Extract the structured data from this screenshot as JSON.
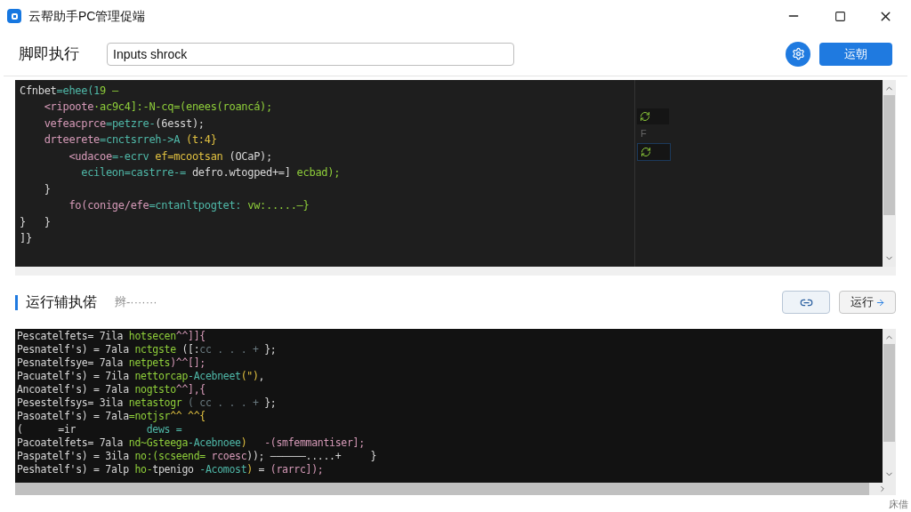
{
  "window": {
    "title": "云帮助手PC管理促端"
  },
  "toolbar": {
    "heading": "脚即执行",
    "input": {
      "value": "Inputs shrock"
    },
    "primary_button": "运朝"
  },
  "editor": {
    "lines": [
      [
        {
          "kind": "plain",
          "text": "Cfnbet"
        },
        {
          "kind": "teal",
          "text": "=ehee(1"
        },
        {
          "kind": "green",
          "text": "9 –"
        }
      ],
      [
        {
          "kind": "pink",
          "text": "    <ripoote"
        },
        {
          "kind": "green",
          "text": "·ac9c4]:-N-cq=(enees(roancá);"
        }
      ],
      [
        {
          "kind": "pink",
          "text": "    vefeacprce"
        },
        {
          "kind": "teal",
          "text": "=petzre-"
        },
        {
          "kind": "plain",
          "text": "(6esst);"
        }
      ],
      [
        {
          "kind": "pink",
          "text": "    drteerete"
        },
        {
          "kind": "teal",
          "text": "=cnctsrreh->A "
        },
        {
          "kind": "yellow",
          "text": "(t:4}"
        }
      ],
      [
        {
          "kind": "pink",
          "text": "        <udacoe"
        },
        {
          "kind": "teal",
          "text": "=-ecrv "
        },
        {
          "kind": "yellow",
          "text": "ef=mcootsan "
        },
        {
          "kind": "plain",
          "text": "(OCaP);"
        }
      ],
      [
        {
          "kind": "teal",
          "text": "          ecileon=castrre-= "
        },
        {
          "kind": "plain",
          "text": "defro.wtogped+=] "
        },
        {
          "kind": "green",
          "text": "ecbad);"
        }
      ],
      [
        {
          "kind": "plain",
          "text": "    }"
        }
      ],
      [
        {
          "kind": "pink",
          "text": "        fo(conige/efe"
        },
        {
          "kind": "teal",
          "text": "=cntanltpogtet: "
        },
        {
          "kind": "green",
          "text": "vw:.....–}"
        }
      ],
      [
        {
          "kind": "plain",
          "text": "}   }"
        }
      ],
      [
        {
          "kind": "plain",
          "text": "]}"
        }
      ]
    ],
    "side_label": "F"
  },
  "output": {
    "heading": "运行辅执偌",
    "subheading": "辫-·······",
    "run_button": "运行",
    "lines": [
      [
        {
          "kind": "plain",
          "text": "Pescatelfets= 7ila "
        },
        {
          "kind": "green",
          "text": "hotsecen"
        },
        {
          "kind": "pink",
          "text": "^^]]{"
        }
      ],
      [
        {
          "kind": "plain",
          "text": "Pesnatelf's) = 7ala "
        },
        {
          "kind": "green",
          "text": "nctgste "
        },
        {
          "kind": "plain",
          "text": "([:"
        },
        {
          "kind": "dim",
          "text": "cc . . . +"
        },
        {
          "kind": "plain",
          "text": " };"
        }
      ],
      [
        {
          "kind": "plain",
          "text": "Pesnatelfsye= 7ala "
        },
        {
          "kind": "green",
          "text": "netpets"
        },
        {
          "kind": "pink",
          "text": ")^^[];"
        }
      ],
      [
        {
          "kind": "plain",
          "text": "Pacuatelf's) = 7ila "
        },
        {
          "kind": "green",
          "text": "nettorcap"
        },
        {
          "kind": "teal",
          "text": "-Acebneet"
        },
        {
          "kind": "yellow",
          "text": "(\")"
        },
        {
          "kind": "plain",
          "text": ","
        }
      ],
      [
        {
          "kind": "plain",
          "text": "Ancoatelf's) = 7ala "
        },
        {
          "kind": "green",
          "text": "nogtsto"
        },
        {
          "kind": "pink",
          "text": "^^],{"
        }
      ],
      [
        {
          "kind": "plain",
          "text": "Pesestelfsys= 3ila "
        },
        {
          "kind": "green",
          "text": "netastogr "
        },
        {
          "kind": "dim",
          "text": "( cc . . . +"
        },
        {
          "kind": "plain",
          "text": " };"
        }
      ],
      [
        {
          "kind": "plain",
          "text": "Pasoatelf's) = 7ala"
        },
        {
          "kind": "green",
          "text": "=notjsr"
        },
        {
          "kind": "yellow",
          "text": "^^ ^^{"
        }
      ],
      [
        {
          "kind": "plain",
          "text": "(      =ir            "
        },
        {
          "kind": "teal",
          "text": "dews ="
        }
      ],
      [
        {
          "kind": "plain",
          "text": "Pacoatelfets= 7ala "
        },
        {
          "kind": "green",
          "text": "nd~Gsteega"
        },
        {
          "kind": "teal",
          "text": "-Acebnoee"
        },
        {
          "kind": "yellow",
          "text": ")"
        },
        {
          "kind": "pink",
          "text": "   -(smfemmantiser];"
        }
      ],
      [
        {
          "kind": "plain",
          "text": "Paspatelf's) = 3ila "
        },
        {
          "kind": "green",
          "text": "no:(scseend= "
        },
        {
          "kind": "pink",
          "text": "rcoesc"
        },
        {
          "kind": "plain",
          "text": ")); ——————.....+     }"
        }
      ],
      [
        {
          "kind": "plain",
          "text": "Peshatelf's) = 7alp "
        },
        {
          "kind": "green",
          "text": "ho-"
        },
        {
          "kind": "plain",
          "text": "tpenigo"
        },
        {
          "kind": "teal",
          "text": " -Acomost"
        },
        {
          "kind": "yellow",
          "text": ")"
        },
        {
          "kind": "plain",
          "text": " = "
        },
        {
          "kind": "pink",
          "text": "(rarrc]);"
        }
      ]
    ]
  },
  "status_bar": {
    "text": "床借"
  }
}
